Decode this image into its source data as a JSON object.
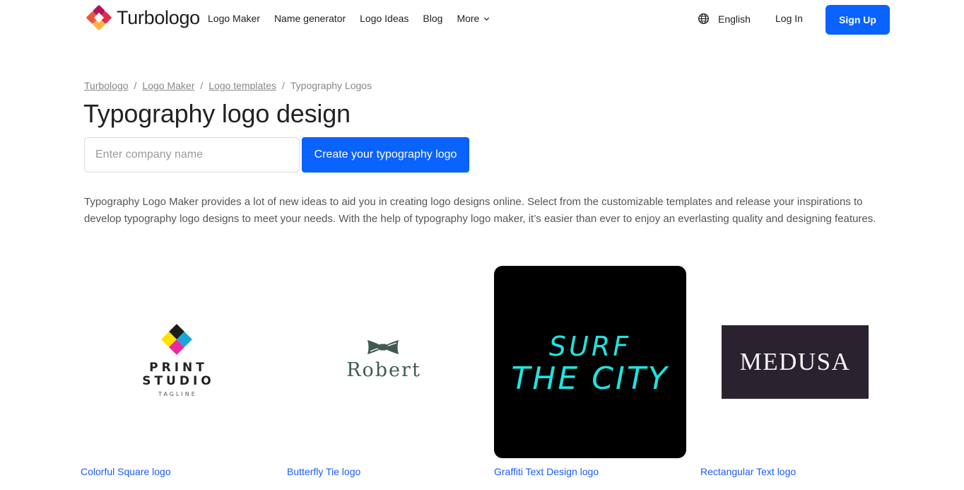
{
  "header": {
    "brand_name": "Turbologo",
    "nav": [
      {
        "label": "Logo Maker"
      },
      {
        "label": "Name generator"
      },
      {
        "label": "Logo Ideas"
      },
      {
        "label": "Blog"
      },
      {
        "label": "More",
        "icon": "chevron-down-icon"
      }
    ],
    "language": {
      "label": "English",
      "icon": "globe-icon"
    },
    "login_label": "Log In",
    "signup_label": "Sign Up"
  },
  "breadcrumb": [
    {
      "label": "Turbologo",
      "link": true
    },
    {
      "label": "Logo Maker",
      "link": true
    },
    {
      "label": "Logo templates",
      "link": true
    },
    {
      "label": "Typography Logos",
      "link": false
    }
  ],
  "breadcrumb_separator": "/",
  "page_title": "Typography logo design",
  "search": {
    "placeholder": "Enter company name",
    "value": "",
    "button_label": "Create your typography logo"
  },
  "description": "Typography Logo Maker provides a lot of new ideas to aid you in creating logo designs online. Select from the customizable templates and release your inspirations to develop typography logo designs to meet your needs. With the help of typography logo maker, it’s easier than ever to enjoy an everlasting quality and designing features.",
  "colors": {
    "accent": "#0a62ff",
    "link": "#1a5cff",
    "surf_text": "#1fe3df",
    "medusa_bg": "#2a232f",
    "robert_text": "#3e5a53"
  },
  "templates": [
    {
      "label": "Colorful Square logo",
      "preview": {
        "line1": "PRINT",
        "line2": "STUDIO",
        "tagline": "TAGLINE"
      }
    },
    {
      "label": "Butterfly Tie logo",
      "preview": {
        "name": "Robert"
      }
    },
    {
      "label": "Graffiti Text Design logo",
      "preview": {
        "line1": "SURF",
        "line2": "THE CITY"
      }
    },
    {
      "label": "Rectangular Text logo",
      "preview": {
        "name": "MEDUSA"
      }
    }
  ]
}
